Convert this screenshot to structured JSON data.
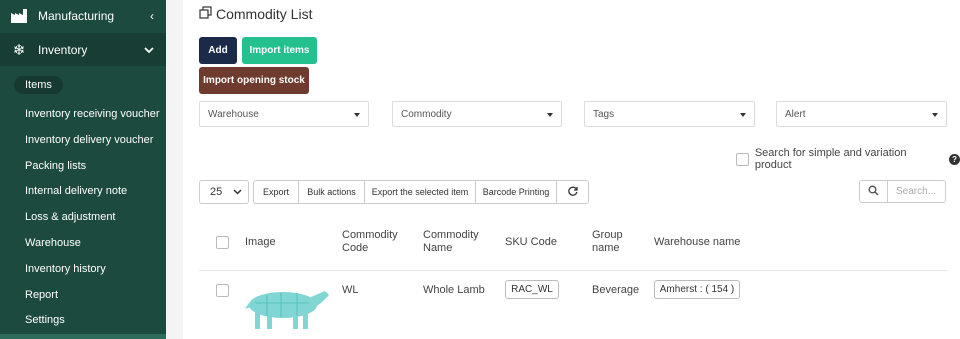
{
  "sidebar": {
    "manufacturing": "Manufacturing",
    "inventory": "Inventory",
    "items": [
      {
        "label": "Items"
      },
      {
        "label": "Inventory receiving voucher"
      },
      {
        "label": "Inventory delivery voucher"
      },
      {
        "label": "Packing lists"
      },
      {
        "label": "Internal delivery note"
      },
      {
        "label": "Loss & adjustment"
      },
      {
        "label": "Warehouse"
      },
      {
        "label": "Inventory history"
      },
      {
        "label": "Report"
      },
      {
        "label": "Settings"
      }
    ]
  },
  "page": {
    "title": "Commodity List"
  },
  "buttons": {
    "add": "Add",
    "import_items": "Import items",
    "import_opening": "Import opening stock"
  },
  "filters": {
    "warehouse": "Warehouse",
    "commodity": "Commodity",
    "tags": "Tags",
    "alert": "Alert"
  },
  "search_variation": {
    "label": "Search for simple and variation product"
  },
  "table_tools": {
    "page_size": "25",
    "export": "Export",
    "bulk_actions": "Bulk actions",
    "export_selected": "Export the selected item",
    "barcode": "Barcode Printing",
    "search_placeholder": "Search..."
  },
  "table": {
    "headers": {
      "image": "Image",
      "commodity_code": [
        "Commodity",
        "Code"
      ],
      "commodity_name": [
        "Commodity",
        "Name"
      ],
      "sku": "SKU Code",
      "group": [
        "Group",
        "name"
      ],
      "warehouse": "Warehouse name"
    },
    "rows": [
      {
        "code": "WL",
        "name": "Whole Lamb",
        "sku": "RAC_WL",
        "group": "Beverage",
        "warehouse": "Amherst : ( 154 )"
      }
    ]
  },
  "colors": {
    "sidebar": "#1d4a3f",
    "add_button": "#1c2a4a",
    "import_button": "#24c18f",
    "opening_button": "#6e3b2e"
  }
}
